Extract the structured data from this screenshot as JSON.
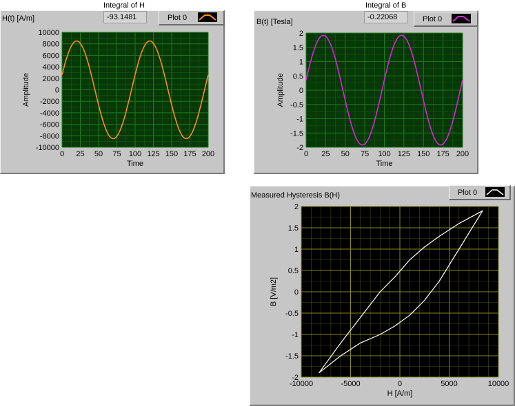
{
  "chart_data": [
    {
      "type": "line",
      "title": "H(t) [A/m]",
      "xlabel": "Time",
      "ylabel": "Amplitude",
      "xlim": [
        0,
        200
      ],
      "ylim": [
        -10000,
        10000
      ],
      "xticks": [
        "0",
        "25",
        "50",
        "75",
        "100",
        "125",
        "150",
        "175",
        "200"
      ],
      "yticks": [
        "10000",
        "8000",
        "6000",
        "4000",
        "2000",
        "0",
        "-2000",
        "-4000",
        "-6000",
        "-8000",
        "-10000"
      ],
      "grid": true,
      "legend": "top-right",
      "series": [
        {
          "name": "Plot 0",
          "color": "#ff8c1a",
          "waveform": "sine",
          "amplitude": 8500,
          "period": 100,
          "peak_at": 20,
          "x": [
            0,
            10,
            20,
            30,
            40,
            50,
            60,
            70,
            80,
            90,
            100,
            110,
            120,
            130,
            140,
            150,
            160,
            170,
            180,
            190,
            200
          ],
          "values": [
            3000,
            6900,
            8500,
            7200,
            3500,
            -1500,
            -6000,
            -8200,
            -7800,
            -4500,
            2800,
            6800,
            8500,
            7300,
            3600,
            -1500,
            -6000,
            -8200,
            -7800,
            -4500,
            2800
          ]
        }
      ]
    },
    {
      "type": "line",
      "title": "B(t) [Tesla]",
      "xlabel": "Time",
      "ylabel": "Amplitude",
      "xlim": [
        0,
        200
      ],
      "ylim": [
        -2,
        2
      ],
      "xticks": [
        "0",
        "25",
        "50",
        "75",
        "100",
        "125",
        "150",
        "175",
        "200"
      ],
      "yticks": [
        "2",
        "1.5",
        "1",
        "0.5",
        "0",
        "-0.5",
        "-1",
        "-1.5",
        "-2"
      ],
      "grid": true,
      "legend": "top-right",
      "series": [
        {
          "name": "Plot 0",
          "color": "#e020e0",
          "waveform": "sine",
          "amplitude": 1.92,
          "period": 100,
          "peak_at": 22,
          "x": [
            0,
            10,
            20,
            30,
            40,
            50,
            60,
            70,
            80,
            90,
            100,
            110,
            120,
            130,
            140,
            150,
            160,
            170,
            180,
            190,
            200
          ],
          "values": [
            0.15,
            1.3,
            1.9,
            1.7,
            0.8,
            -0.4,
            -1.45,
            -1.92,
            -1.6,
            -0.7,
            0.15,
            1.3,
            1.9,
            1.7,
            0.8,
            -0.4,
            -1.45,
            -1.92,
            -1.6,
            -0.7,
            0.1
          ]
        }
      ]
    },
    {
      "type": "line",
      "title": "Measured Hysteresis B(H)",
      "xlabel": "H [A/m]",
      "ylabel": "B [V/m2]",
      "xlim": [
        -10000,
        10000
      ],
      "ylim": [
        -2,
        2
      ],
      "xticks": [
        "-10000",
        "-5000",
        "0",
        "5000",
        "10000"
      ],
      "yticks": [
        "2",
        "1.5",
        "1",
        "0.5",
        "0",
        "-0.5",
        "-1",
        "-1.5",
        "-2"
      ],
      "grid": true,
      "legend": "top-right",
      "series": [
        {
          "name": "Plot 0",
          "color": "#ffffff",
          "upper": {
            "x": [
              -8200,
              -6000,
              -4000,
              -2000,
              -500,
              1000,
              2500,
              4000,
              6000,
              8400
            ],
            "values": [
              -1.9,
              -1.2,
              -0.6,
              0.0,
              0.35,
              0.75,
              1.05,
              1.3,
              1.6,
              1.9
            ]
          },
          "lower": {
            "x": [
              8400,
              6000,
              4000,
              2500,
              1000,
              -500,
              -2000,
              -4000,
              -6000,
              -8200
            ],
            "values": [
              1.9,
              1.0,
              0.25,
              -0.2,
              -0.55,
              -0.8,
              -1.0,
              -1.2,
              -1.5,
              -1.9
            ]
          }
        }
      ]
    }
  ],
  "indicators": {
    "integral_h_label": "Integral of H",
    "integral_h_value": "-93.1481",
    "integral_b_label": "Integral of B",
    "integral_b_value": "-0.22068"
  },
  "legends": {
    "h_plot": "Plot 0",
    "b_plot": "Plot 0",
    "hyst_plot": "Plot 0"
  },
  "colors": {
    "plot_bg_small": "#073807",
    "grid_small": "#1e7a1e",
    "plot_bg_large": "#000000",
    "grid_large": "#88861e",
    "panel": "#c6c6c6"
  }
}
